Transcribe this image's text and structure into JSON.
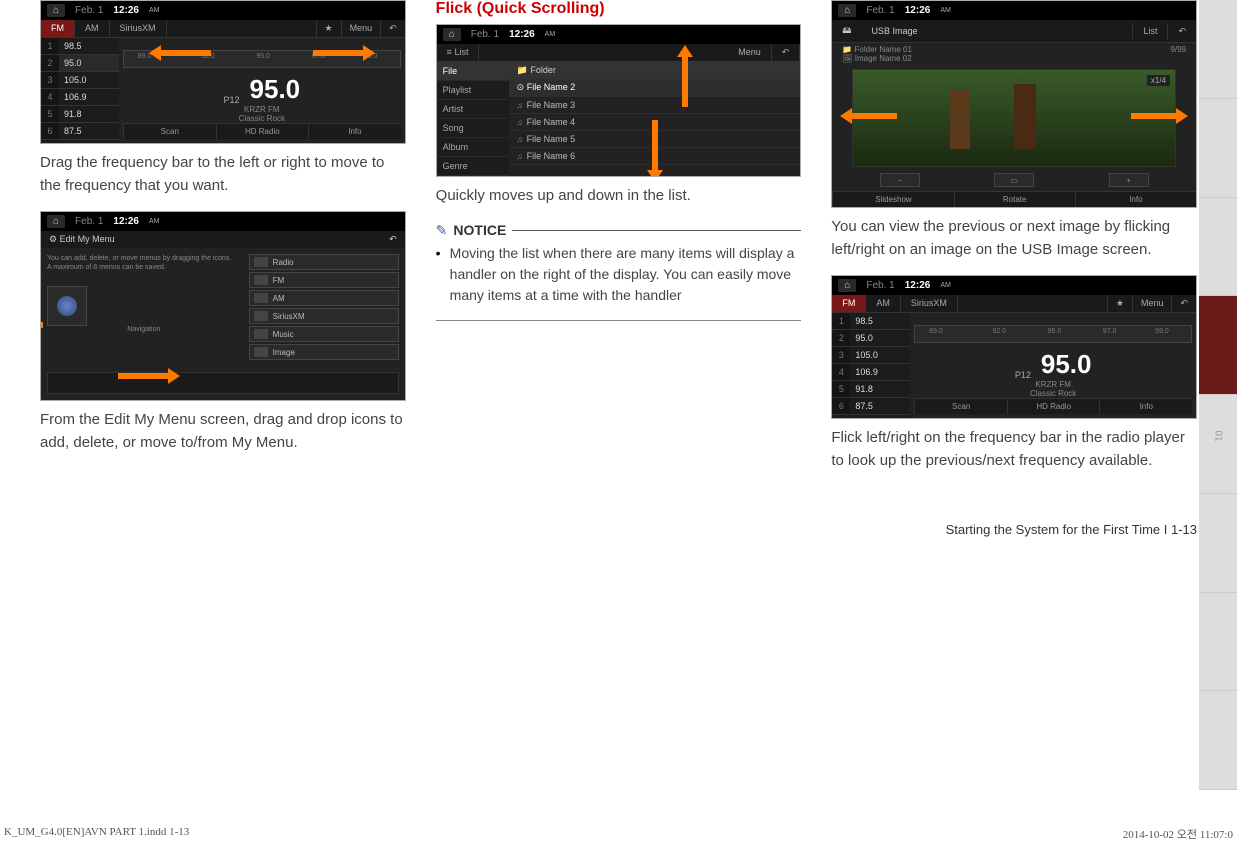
{
  "col1": {
    "shot1": {
      "date": "Feb. 1",
      "time": "12:26",
      "ampm": "AM",
      "tabs": {
        "fm": "FM",
        "am": "AM",
        "sxm": "SiriusXM",
        "menu": "Menu"
      },
      "presets": [
        {
          "n": "1",
          "f": "98.5"
        },
        {
          "n": "2",
          "f": "95.0"
        },
        {
          "n": "3",
          "f": "105.0"
        },
        {
          "n": "4",
          "f": "106.9"
        },
        {
          "n": "5",
          "f": "91.8"
        },
        {
          "n": "6",
          "f": "87.5"
        }
      ],
      "dial": {
        "a": "89.0",
        "b": "92.0",
        "c": "95.0",
        "d": "97.0",
        "e": "99.0"
      },
      "pnum": "P12",
      "big": "95.0",
      "sub1": "KRZR FM",
      "sub2": "Classic Rock",
      "foot": {
        "scan": "Scan",
        "hd": "HD Radio",
        "info": "Info"
      }
    },
    "text1": "Drag the frequency bar to the left or right to move to the frequency that you want.",
    "shot2": {
      "date": "Feb. 1",
      "time": "12:26",
      "ampm": "AM",
      "title": "Edit My Menu",
      "help1": "You can add, delete, or move menus by dragging the icons.",
      "help2": "A maximum of 8 menus can be saved.",
      "navlabel": "Navigation",
      "items": [
        {
          "label": "Radio"
        },
        {
          "label": "FM"
        },
        {
          "label": "AM"
        },
        {
          "label": "SiriusXM"
        },
        {
          "label": "Music"
        },
        {
          "label": "Image"
        }
      ]
    },
    "text2": "From the Edit My Menu screen, drag and drop icons to add, delete, or move to/from My Menu."
  },
  "col2": {
    "heading": "Flick (Quick Scrolling)",
    "shot": {
      "date": "Feb. 1",
      "time": "12:26",
      "ampm": "AM",
      "listbtn": "List",
      "menubtn": "Menu",
      "cats": [
        "File",
        "Playlist",
        "Artist",
        "Song",
        "Album",
        "Genre"
      ],
      "folder": "Folder",
      "files": [
        "File Name 2",
        "File Name 3",
        "File Name 4",
        "File Name 5",
        "File Name 6"
      ]
    },
    "text1": "Quickly moves up and down in the list.",
    "notice_title": "NOTICE",
    "notice_item": "Moving the list when there are many items will display a handler on the right of the display. You can easily move many items at a time with the handler"
  },
  "col3": {
    "shot1": {
      "date": "Feb. 1",
      "time": "12:26",
      "ampm": "AM",
      "title": "USB Image",
      "listbtn": "List",
      "folder1": "Folder Name 01",
      "image1": "Image Name 02",
      "count": "9/99",
      "scale": "x1/4",
      "foot": {
        "a": "Slideshow",
        "b": "Rotate",
        "c": "Info"
      }
    },
    "text1": "You can view the previous or next image by flicking left/right on an image on the USB Image screen.",
    "shot2": {
      "date": "Feb. 1",
      "time": "12:26",
      "ampm": "AM",
      "tabs": {
        "fm": "FM",
        "am": "AM",
        "sxm": "SiriusXM",
        "menu": "Menu"
      },
      "presets": [
        {
          "n": "1",
          "f": "98.5"
        },
        {
          "n": "2",
          "f": "95.0"
        },
        {
          "n": "3",
          "f": "105.0"
        },
        {
          "n": "4",
          "f": "106.9"
        },
        {
          "n": "5",
          "f": "91.8"
        },
        {
          "n": "6",
          "f": "87.5"
        }
      ],
      "dial": {
        "a": "89.0",
        "b": "92.0",
        "c": "95.0",
        "d": "97.0",
        "e": "99.0"
      },
      "pnum": "P12",
      "big": "95.0",
      "sub1": "KRZR FM",
      "sub2": "Classic Rock",
      "foot": {
        "scan": "Scan",
        "hd": "HD Radio",
        "info": "Info"
      }
    },
    "text2": "Flick left/right on the frequency bar in the radio player to look up the previous/next frequency available.",
    "footer_right": "Starting the System for the First Time I 1-13"
  },
  "sidetab": "01",
  "docfoot": {
    "left": "K_UM_G4.0[EN]AVN PART 1.indd   1-13",
    "right": "2014-10-02   오전 11:07:0"
  }
}
